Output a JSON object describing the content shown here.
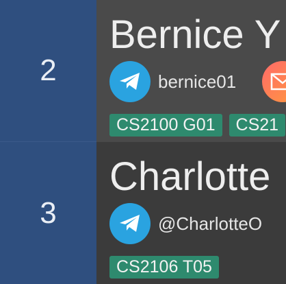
{
  "persons": [
    {
      "index": "2",
      "name": "Bernice Y",
      "telegram": "bernice01",
      "tags": [
        "CS2100 G01",
        "CS21"
      ]
    },
    {
      "index": "3",
      "name": "Charlotte",
      "telegram": "@CharlotteO",
      "tags": [
        "CS2106 T05"
      ]
    }
  ],
  "colors": {
    "index_bg": "#2f4f7f",
    "tag_bg": "#2e8a6e",
    "telegram": "#2aa3e0"
  }
}
